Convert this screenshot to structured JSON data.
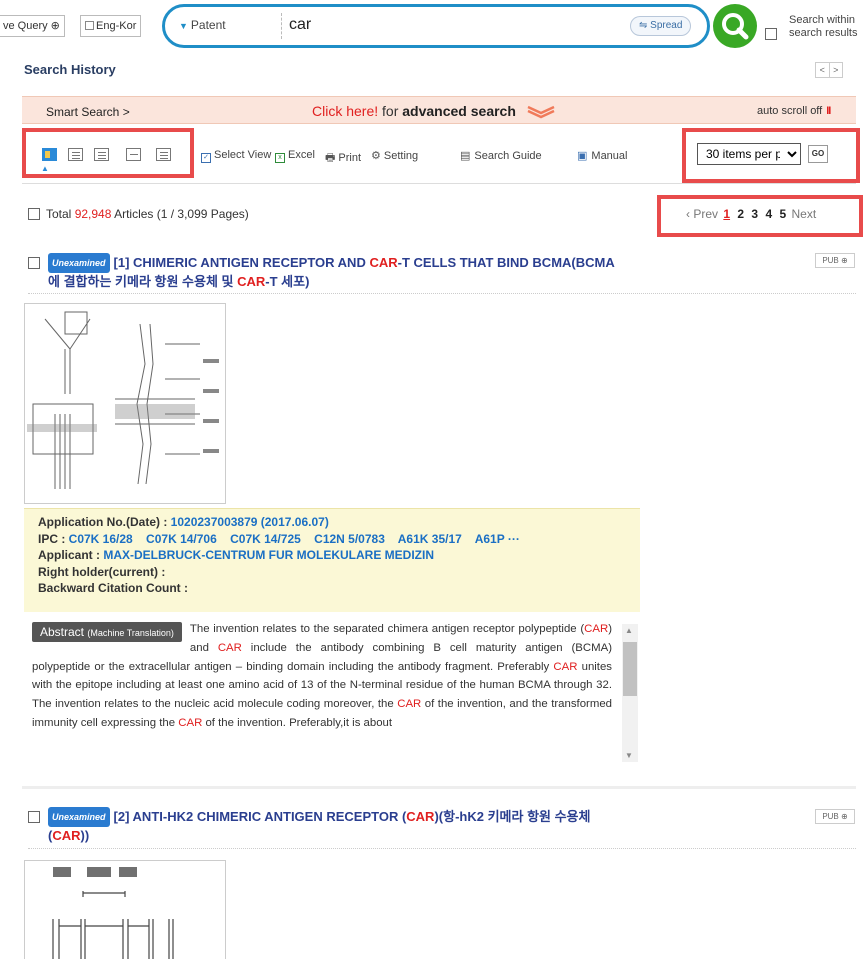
{
  "top": {
    "query_btn": "ve Query ⊕",
    "eng_kor": "Eng-Kor",
    "search_type": "Patent",
    "search_value": "car",
    "spread": "Spread",
    "within_line1": "Search within",
    "within_line2": "search results"
  },
  "history": {
    "title": "Search History",
    "nav_prev": "<",
    "nav_next": ">"
  },
  "smart": {
    "label": "Smart Search >",
    "click_red": "Click here!",
    "click_mid": " for ",
    "click_bold": "advanced search",
    "auto_scroll": "auto scroll off",
    "auto_ico": "II"
  },
  "toolbar": {
    "select_view": "Select View",
    "excel": "Excel",
    "print": "Print",
    "setting": "Setting",
    "search_guide": "Search Guide",
    "manual": "Manual",
    "per_page": "30 items per page",
    "go": "GO"
  },
  "summary": {
    "total_prefix": "Total ",
    "total_count": "92,948",
    "total_suffix": " Articles (1 / 3,099 Pages)",
    "prev": "‹ Prev",
    "pages": [
      "1",
      "2",
      "3",
      "4",
      "5"
    ],
    "next": "Next"
  },
  "results": [
    {
      "badge": "Unexamined",
      "title_a": "[1] CHIMERIC ANTIGEN RECEPTOR AND ",
      "title_hl1": "CAR",
      "title_b": "-T CELLS THAT BIND BCMA(BCMA",
      "title_c": "에 결합하는 키메라 항원 수용체 및 ",
      "title_hl2": "CAR",
      "title_d": "-T 세포)",
      "pub": "PUB ⊕",
      "app_label": "Application No.(Date) : ",
      "app_value": "1020237003879 (2017.06.07)",
      "ipc_label": "IPC : ",
      "ipc_value": "C07K 16/28    C07K 14/706    C07K 14/725    C12N 5/0783    A61K 35/17    A61P ···",
      "applicant_label": "Applicant : ",
      "applicant_value": "MAX-DELBRUCK-CENTRUM FUR MOLEKULARE MEDIZIN",
      "right_holder": "Right holder(current) :",
      "backward": "Backward Citation Count :",
      "abstract_label": "Abstract",
      "abstract_sub": "(Machine Translation)",
      "abs_1": "The invention relates to the separated chimera antigen receptor polypeptide (",
      "abs_hl1": "CAR",
      "abs_2": ") and ",
      "abs_hl2": "CAR",
      "abs_3": " include the antibody combining B cell maturity antigen (BCMA) polypeptide or the extracellular antigen – binding domain including the antibody fragment. Preferably ",
      "abs_hl3": "CAR",
      "abs_4": " unites with the epitope including at least one amino acid of 13 of the N-terminal residue of the human BCMA through 32. The invention relates to the nucleic acid molecule coding moreover, the ",
      "abs_hl4": "CAR",
      "abs_5": " of the invention, and the transformed immunity cell expressing the ",
      "abs_hl5": "CAR",
      "abs_6": " of the invention. Preferably,it is about"
    },
    {
      "badge": "Unexamined",
      "title_a": "[2] ANTI-HK2 CHIMERIC ANTIGEN RECEPTOR (",
      "title_hl1": "CAR",
      "title_b": ")(항-hK2 키메라 항원 수용체",
      "title_c": "(",
      "title_hl2": "CAR",
      "title_d": "))",
      "pub": "PUB ⊕"
    }
  ],
  "colors": {
    "accent_blue": "#1f8ec7",
    "highlight_red": "#e02020",
    "search_green": "#39a825",
    "annotation_red": "#e84b4b"
  }
}
